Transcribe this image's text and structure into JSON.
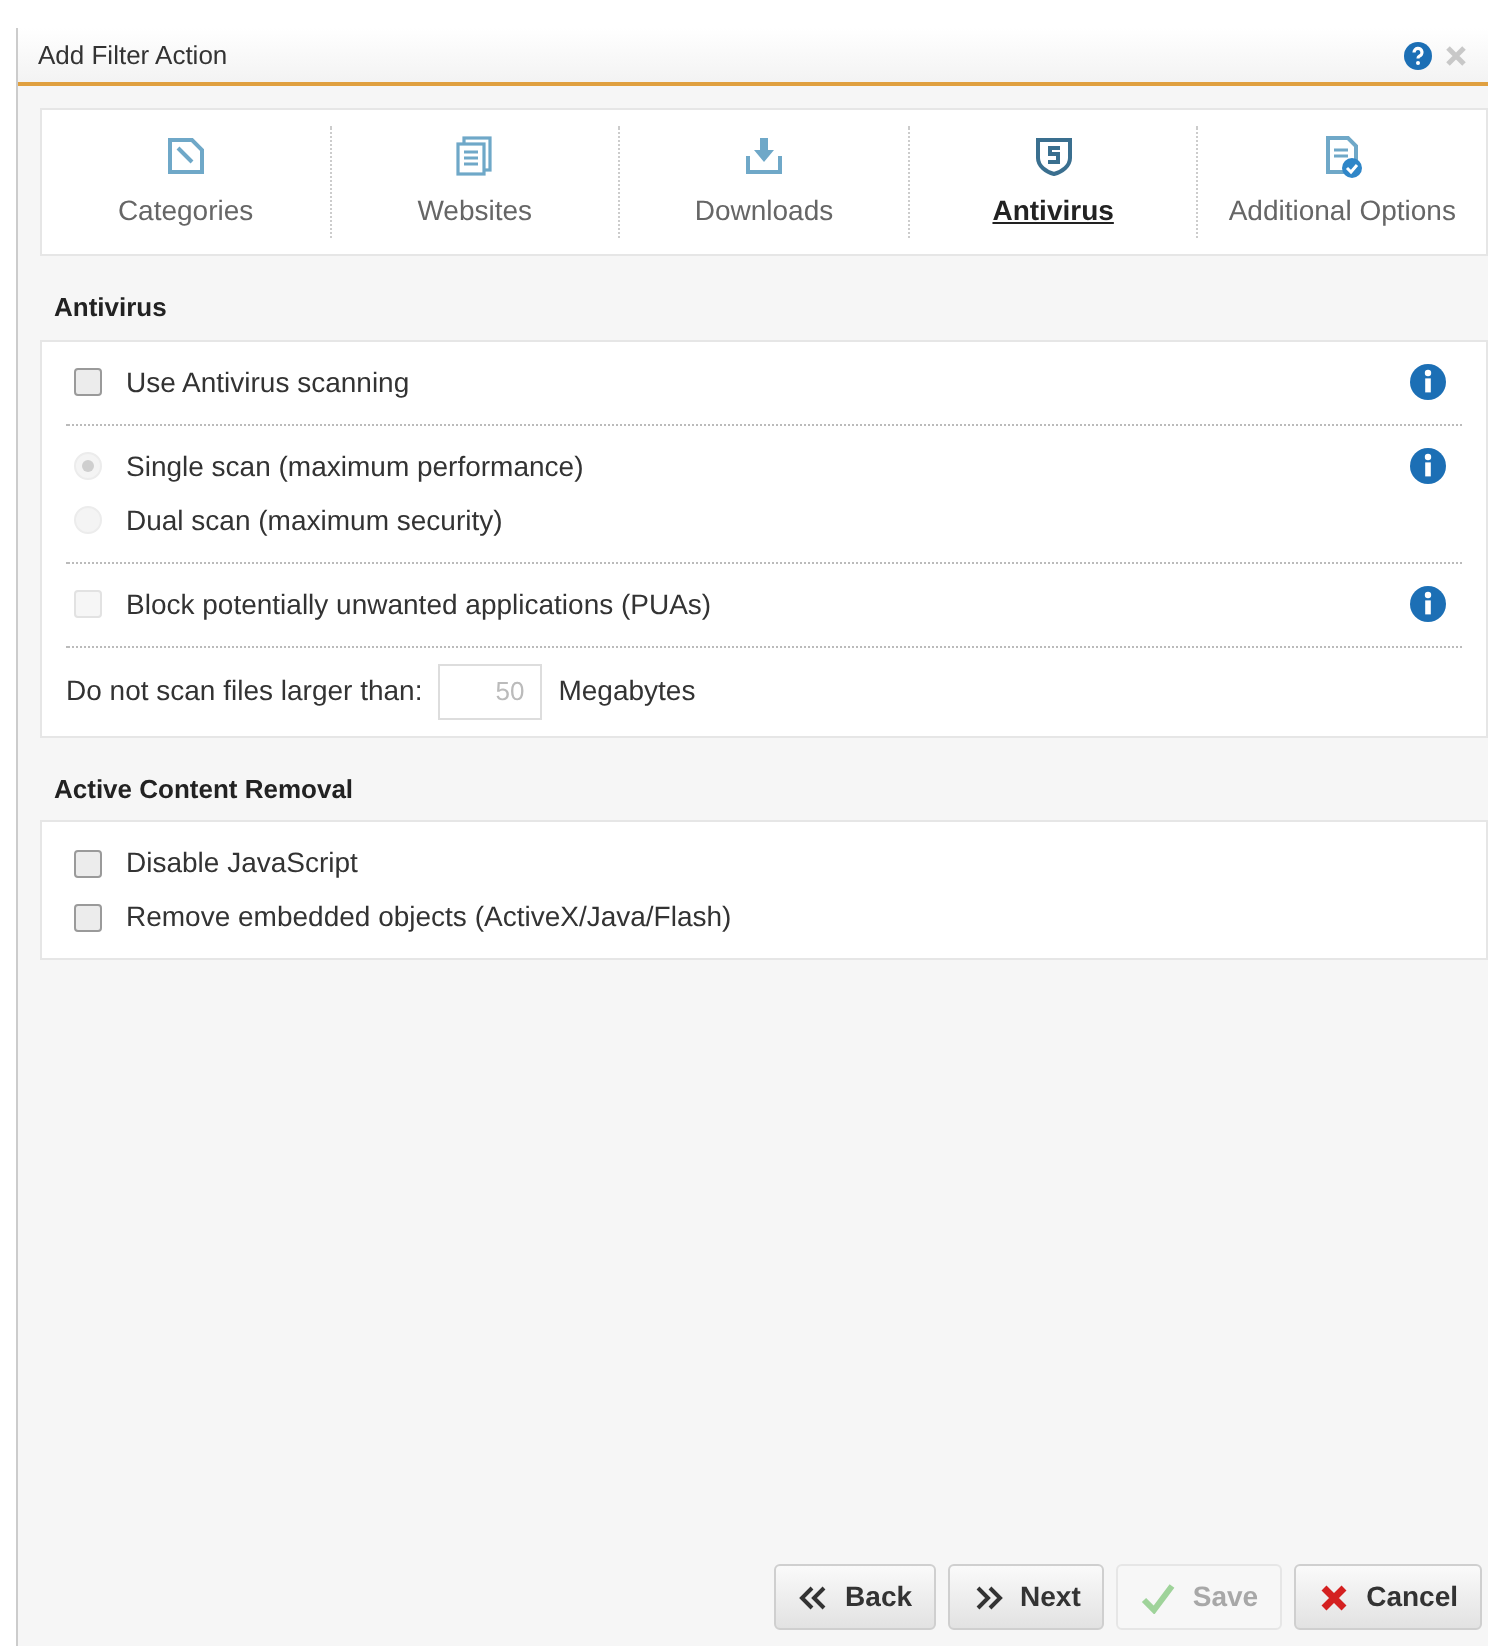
{
  "window": {
    "title": "Add Filter Action"
  },
  "tabs": [
    {
      "label": "Categories",
      "selected": false
    },
    {
      "label": "Websites",
      "selected": false
    },
    {
      "label": "Downloads",
      "selected": false
    },
    {
      "label": "Antivirus",
      "selected": true
    },
    {
      "label": "Additional Options",
      "selected": false
    }
  ],
  "sections": [
    {
      "title": "Antivirus",
      "groups": [
        {
          "kind": "checkbox",
          "info": true,
          "items": [
            {
              "label": "Use Antivirus scanning",
              "checked": false,
              "disabled": false
            }
          ]
        },
        {
          "kind": "radio",
          "info": true,
          "items": [
            {
              "label": "Single scan (maximum performance)",
              "selected": true,
              "disabled": true
            },
            {
              "label": "Dual scan (maximum security)",
              "selected": false,
              "disabled": true
            }
          ]
        },
        {
          "kind": "checkbox",
          "info": true,
          "items": [
            {
              "label": "Block potentially unwanted applications (PUAs)",
              "checked": false,
              "disabled": true
            }
          ]
        },
        {
          "kind": "number",
          "label": "Do not scan files larger than:",
          "value": "50",
          "unit": "Megabytes",
          "disabled": true
        }
      ]
    },
    {
      "title": "Active Content Removal",
      "groups": [
        {
          "kind": "checkbox",
          "info": false,
          "items": [
            {
              "label": "Disable JavaScript",
              "checked": false,
              "disabled": false
            },
            {
              "label": "Remove embedded objects (ActiveX/Java/Flash)",
              "checked": false,
              "disabled": false
            }
          ]
        }
      ]
    }
  ],
  "buttons": [
    {
      "label": "Back",
      "kind": "back",
      "disabled": false
    },
    {
      "label": "Next",
      "kind": "next",
      "disabled": false
    },
    {
      "label": "Save",
      "kind": "save",
      "disabled": true
    },
    {
      "label": "Cancel",
      "kind": "cancel",
      "disabled": false
    }
  ]
}
